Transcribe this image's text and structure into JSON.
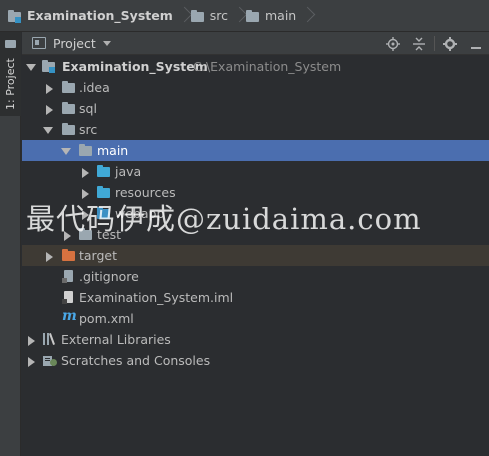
{
  "breadcrumb": {
    "items": [
      {
        "label": "Examination_System",
        "icon": "module-folder-icon"
      },
      {
        "label": "src",
        "icon": "folder-icon"
      },
      {
        "label": "main",
        "icon": "folder-icon"
      }
    ]
  },
  "side_strip": {
    "tab_label": "1: Project"
  },
  "panel": {
    "title": "Project"
  },
  "tree": {
    "root": {
      "name": "Examination_System",
      "path": "C:\\Examination_System"
    },
    "idea": ".idea",
    "sql": "sql",
    "src": "src",
    "main": "main",
    "java": "java",
    "resources": "resources",
    "webapp": "webapp",
    "test": "test",
    "target": "target",
    "gitignore": ".gitignore",
    "iml": "Examination_System.iml",
    "pom": "pom.xml",
    "external_libraries": "External Libraries",
    "scratches": "Scratches and Consoles"
  },
  "watermark": "最代码伊成@zuidaima.com",
  "colors": {
    "selection": "#4b6eaf",
    "excluded_row": "#3e3a34",
    "folder_gray": "#9aa7b0",
    "folder_source": "#40a9d6",
    "folder_excluded": "#d67240",
    "maven": "#4aa8e8"
  }
}
